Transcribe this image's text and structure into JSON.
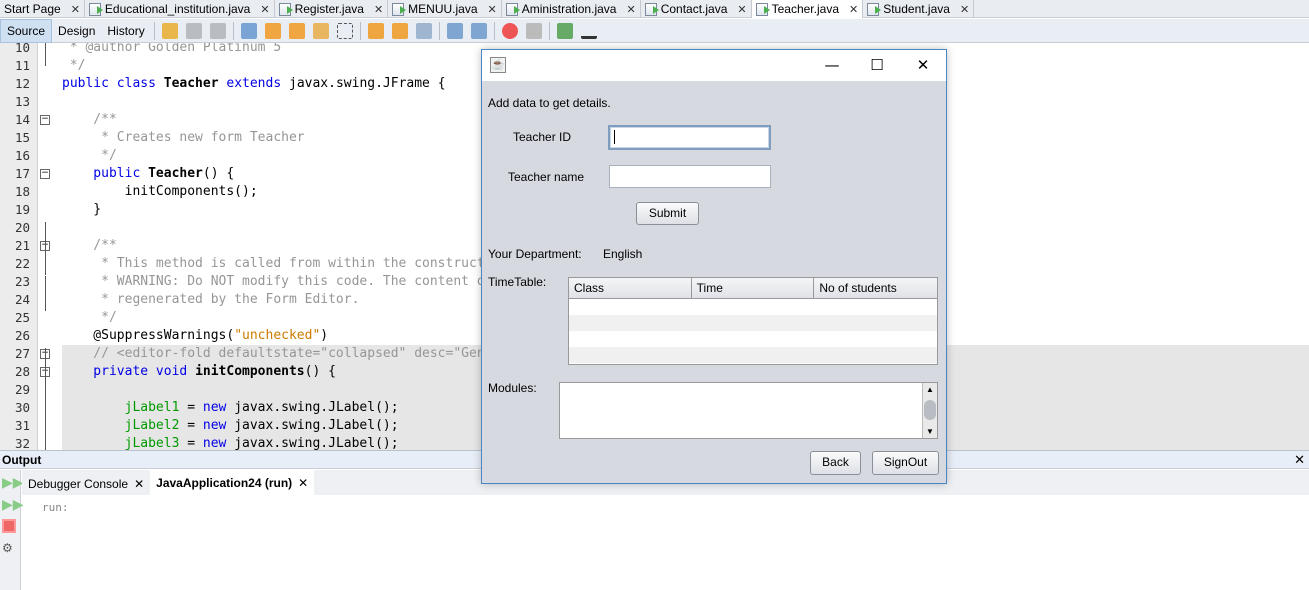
{
  "file_tabs": [
    {
      "label": "Start Page",
      "icon": false,
      "active": false
    },
    {
      "label": "Educational_institution.java",
      "icon": true,
      "active": false
    },
    {
      "label": "Register.java",
      "icon": true,
      "active": false
    },
    {
      "label": "MENUU.java",
      "icon": true,
      "active": false
    },
    {
      "label": "Aministration.java",
      "icon": true,
      "active": false
    },
    {
      "label": "Contact.java",
      "icon": true,
      "active": false
    },
    {
      "label": "Teacher.java",
      "icon": true,
      "active": true
    },
    {
      "label": "Student.java",
      "icon": true,
      "active": false
    }
  ],
  "toolbar": {
    "source": "Source",
    "design": "Design",
    "history": "History"
  },
  "editor": {
    "lines": [
      {
        "n": "10",
        "segs": [
          [
            " * @author Golden Platinum 5",
            "cm"
          ]
        ]
      },
      {
        "n": "11",
        "segs": [
          [
            " */",
            "cm"
          ]
        ]
      },
      {
        "n": "12",
        "segs": [
          [
            "public class ",
            "kw"
          ],
          [
            "Teacher ",
            "b"
          ],
          [
            "extends ",
            "kw"
          ],
          [
            "javax.swing.JFrame {",
            ""
          ]
        ]
      },
      {
        "n": "13",
        "segs": []
      },
      {
        "n": "14",
        "segs": [
          [
            "    /**",
            "cm"
          ]
        ]
      },
      {
        "n": "15",
        "segs": [
          [
            "     * Creates new form Teacher",
            "cm"
          ]
        ]
      },
      {
        "n": "16",
        "segs": [
          [
            "     */",
            "cm"
          ]
        ]
      },
      {
        "n": "17",
        "segs": [
          [
            "    public ",
            "kw"
          ],
          [
            "Teacher",
            "b"
          ],
          [
            "() {",
            ""
          ]
        ]
      },
      {
        "n": "18",
        "segs": [
          [
            "        initComponents();",
            ""
          ]
        ]
      },
      {
        "n": "19",
        "segs": [
          [
            "    }",
            ""
          ]
        ]
      },
      {
        "n": "20",
        "segs": []
      },
      {
        "n": "21",
        "segs": [
          [
            "    /**",
            "cm"
          ]
        ]
      },
      {
        "n": "22",
        "segs": [
          [
            "     * This method is called from within the constructor to initialize the form.",
            "cm"
          ]
        ]
      },
      {
        "n": "23",
        "segs": [
          [
            "     * WARNING: Do NOT modify this code. The content of this method is always",
            "cm"
          ]
        ]
      },
      {
        "n": "24",
        "segs": [
          [
            "     * regenerated by the Form Editor.",
            "cm"
          ]
        ]
      },
      {
        "n": "25",
        "segs": [
          [
            "     */",
            "cm"
          ]
        ]
      },
      {
        "n": "26",
        "segs": [
          [
            "    @SuppressWarnings(",
            ""
          ],
          [
            "\"unchecked\"",
            "str"
          ],
          [
            ")",
            ""
          ]
        ]
      },
      {
        "n": "27",
        "hl": true,
        "segs": [
          [
            "    // <editor-fold defaultstate=\"collapsed\" desc=\"Generated Code\">",
            "cm"
          ]
        ]
      },
      {
        "n": "28",
        "hl": true,
        "segs": [
          [
            "    private void ",
            "kw"
          ],
          [
            "initComponents",
            "b"
          ],
          [
            "() {",
            ""
          ]
        ]
      },
      {
        "n": "29",
        "hl": true,
        "segs": []
      },
      {
        "n": "30",
        "hl": true,
        "segs": [
          [
            "        jLabel1",
            "fld"
          ],
          [
            " = ",
            ""
          ],
          [
            "new ",
            "kw"
          ],
          [
            "javax.swing.JLabel();",
            ""
          ]
        ]
      },
      {
        "n": "31",
        "hl": true,
        "segs": [
          [
            "        jLabel2",
            "fld"
          ],
          [
            " = ",
            ""
          ],
          [
            "new ",
            "kw"
          ],
          [
            "javax.swing.JLabel();",
            ""
          ]
        ]
      },
      {
        "n": "32",
        "hl": true,
        "segs": [
          [
            "        jLabel3",
            "fld"
          ],
          [
            " = ",
            ""
          ],
          [
            "new ",
            "kw"
          ],
          [
            "javax.swing.JLabel();",
            ""
          ]
        ]
      }
    ]
  },
  "output": {
    "title": "Output",
    "tabs": [
      {
        "label": "Debugger Console"
      },
      {
        "label": "JavaApplication24 (run)"
      }
    ],
    "console": "run:"
  },
  "dialog": {
    "intro": "Add data to get details.",
    "teacher_id_label": "Teacher ID",
    "teacher_id_value": "",
    "teacher_name_label": "Teacher name",
    "teacher_name_value": "",
    "submit": "Submit",
    "department_label": "Your Department:",
    "department_value": "English",
    "timetable_label": "TimeTable:",
    "columns": [
      "Class",
      "Time",
      "No of students"
    ],
    "modules_label": "Modules:",
    "modules_value": "",
    "back": "Back",
    "signout": "SignOut"
  }
}
